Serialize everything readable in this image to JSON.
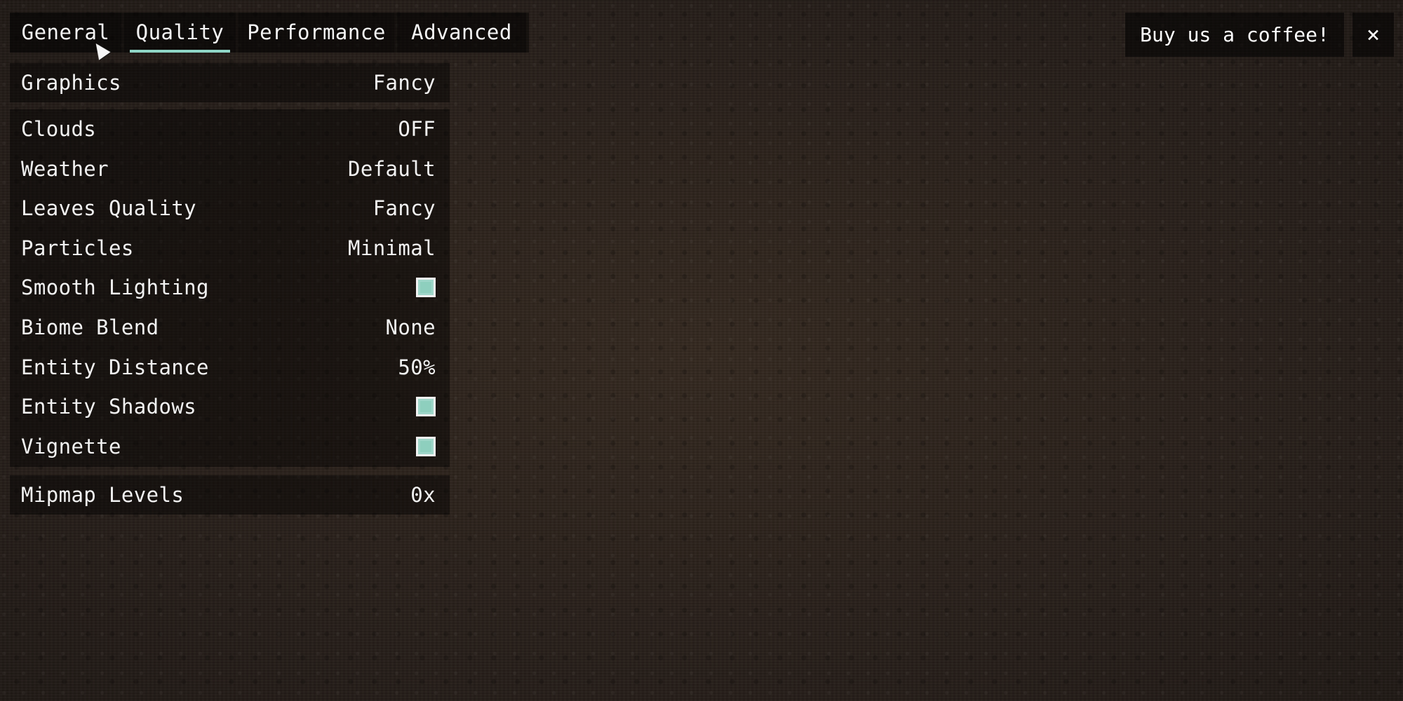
{
  "tabs": [
    {
      "label": "General",
      "active": false
    },
    {
      "label": "Quality",
      "active": true
    },
    {
      "label": "Performance",
      "active": false
    },
    {
      "label": "Advanced",
      "active": false
    }
  ],
  "header": {
    "coffee_label": "Buy us a coffee!",
    "close_label": "×"
  },
  "groups": {
    "top": {
      "graphics": {
        "label": "Graphics",
        "value": "Fancy"
      }
    },
    "main": {
      "clouds": {
        "label": "Clouds",
        "value": "OFF"
      },
      "weather": {
        "label": "Weather",
        "value": "Default"
      },
      "leaves_quality": {
        "label": "Leaves Quality",
        "value": "Fancy"
      },
      "particles": {
        "label": "Particles",
        "value": "Minimal"
      },
      "smooth_lighting": {
        "label": "Smooth Lighting",
        "checked": true
      },
      "biome_blend": {
        "label": "Biome Blend",
        "value": "None"
      },
      "entity_distance": {
        "label": "Entity Distance",
        "value": "50%"
      },
      "entity_shadows": {
        "label": "Entity Shadows",
        "checked": true
      },
      "vignette": {
        "label": "Vignette",
        "checked": true
      }
    },
    "bottom": {
      "mipmap_levels": {
        "label": "Mipmap Levels",
        "value": "0x"
      }
    }
  },
  "colors": {
    "accent": "#8fd6c6",
    "background": "#2a211b",
    "panel": "#0b0908"
  },
  "icons": {
    "cursor": "mouse-pointer-icon",
    "close": "close-icon",
    "checkbox": "checkbox-checked-icon"
  }
}
